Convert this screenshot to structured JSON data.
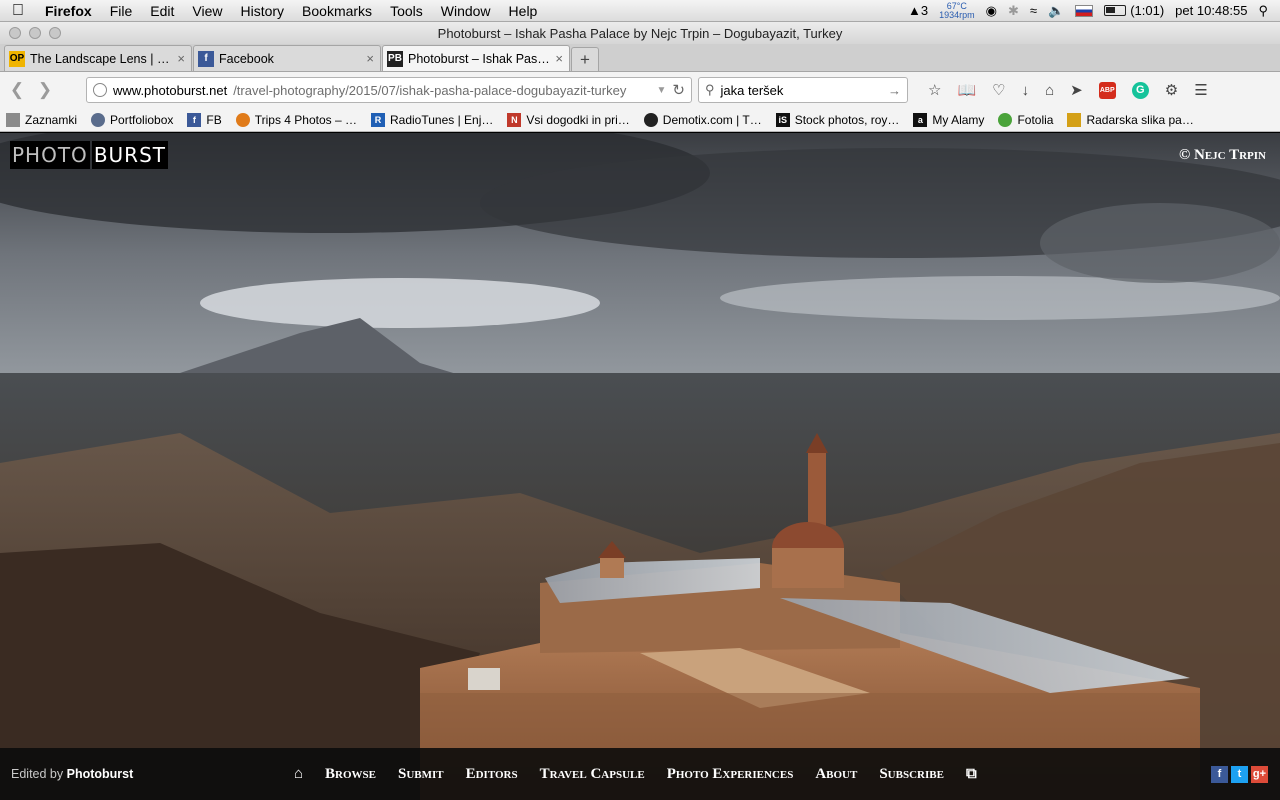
{
  "menubar": {
    "app": "Firefox",
    "items": [
      "File",
      "Edit",
      "View",
      "History",
      "Bookmarks",
      "Tools",
      "Window",
      "Help"
    ],
    "status": {
      "adobe": "3",
      "temp": "67°C",
      "rpm": "1934rpm",
      "battery": "(1:01)",
      "clock": "pet 10:48:55"
    }
  },
  "window": {
    "title": "Photoburst – Ishak Pasha Palace by Nejc Trpin – Dogubayazit, Turkey"
  },
  "tabs": [
    {
      "label": "The Landscape Lens | Ou…",
      "favicon": "OP"
    },
    {
      "label": "Facebook",
      "favicon": "f"
    },
    {
      "label": "Photoburst – Ishak Pasha…",
      "favicon": "PB",
      "active": true
    }
  ],
  "nav": {
    "url_host": "www.photoburst.net",
    "url_path": "/travel-photography/2015/07/ishak-pasha-palace-dogubayazit-turkey",
    "search_value": "jaka teršek"
  },
  "bookmarks": [
    "Zaznamki",
    "Portfoliobox",
    "FB",
    "Trips 4 Photos – …",
    "RadioTunes | Enj…",
    "Vsi dogodki in pri…",
    "Demotix.com | T…",
    "Stock photos, roy…",
    "My Alamy",
    "Fotolia",
    "Radarska slika pa…"
  ],
  "site": {
    "logo_a": "PHOTO",
    "logo_b": "BURST",
    "credit": "© Nejc Trpin",
    "edited_prefix": "Edited by",
    "edited_name": "Photoburst",
    "nav": [
      "Browse",
      "Submit",
      "Editors",
      "Travel Capsule",
      "Photo Experiences",
      "About",
      "Subscribe"
    ]
  },
  "colors": {
    "footer_bg": "#0c0c0c",
    "facebook": "#3b5998",
    "twitter": "#1da1f2",
    "gplus": "#dd4b39"
  }
}
